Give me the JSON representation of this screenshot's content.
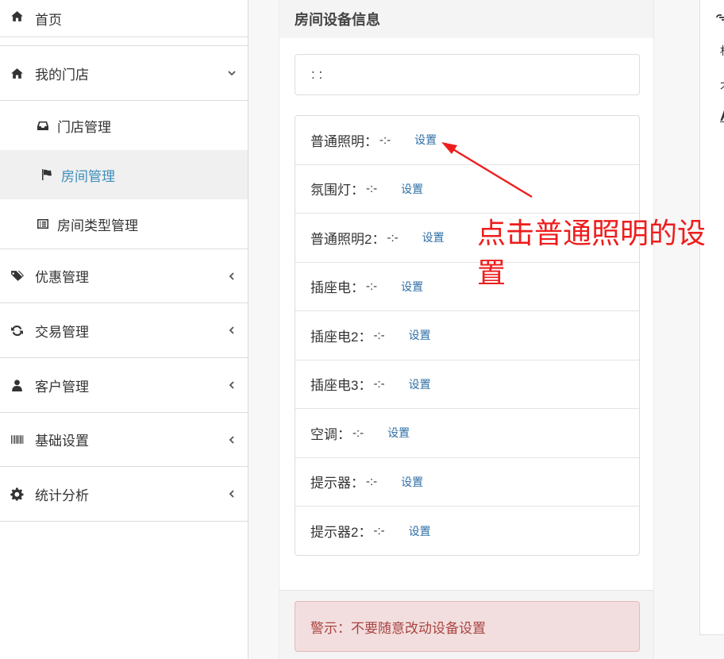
{
  "sidebar": {
    "home": {
      "label": "首页",
      "icon": "home-icon"
    },
    "my_store": {
      "label": "我的门店",
      "icon": "home-icon",
      "expanded": true
    },
    "store_manage": {
      "label": "门店管理",
      "icon": "inbox-icon"
    },
    "room_manage": {
      "label": "房间管理",
      "icon": "flag-icon",
      "active": true
    },
    "room_type_manage": {
      "label": "房间类型管理",
      "icon": "list-alt-icon"
    },
    "discount": {
      "label": "优惠管理",
      "icon": "tags-icon"
    },
    "trade": {
      "label": "交易管理",
      "icon": "refresh-icon"
    },
    "customer": {
      "label": "客户管理",
      "icon": "user-icon"
    },
    "basic_settings": {
      "label": "基础设置",
      "icon": "barcode-icon"
    },
    "statistics": {
      "label": "统计分析",
      "icon": "gear-icon"
    }
  },
  "panel": {
    "title": "房间设备信息",
    "time_value": ": :",
    "devices": [
      {
        "name": "普通照明：",
        "value": "-:-",
        "action": "设置"
      },
      {
        "name": "氛围灯：",
        "value": "-:-",
        "action": "设置"
      },
      {
        "name": "普通照明2：",
        "value": "-:-",
        "action": "设置"
      },
      {
        "name": "插座电：",
        "value": "-:-",
        "action": "设置"
      },
      {
        "name": "插座电2：",
        "value": "-:-",
        "action": "设置"
      },
      {
        "name": "插座电3：",
        "value": "-:-",
        "action": "设置"
      },
      {
        "name": "空调：",
        "value": "-:-",
        "action": "设置"
      },
      {
        "name": "提示器：",
        "value": "-:-",
        "action": "设置"
      },
      {
        "name": "提示器2：",
        "value": "-:-",
        "action": "设置"
      }
    ],
    "warning": "警示：不要随意改动设备设置"
  },
  "right_card": {
    "line1": "机",
    "line2": "才",
    "line3": "A"
  },
  "annotation": {
    "text": "点击普通照明的设置",
    "color": "#ee1d1d"
  },
  "colors": {
    "active_link": "#3c8dbc",
    "action_link": "#2f6fa6",
    "warning_text": "#a94442",
    "warning_bg": "#f2dede"
  }
}
